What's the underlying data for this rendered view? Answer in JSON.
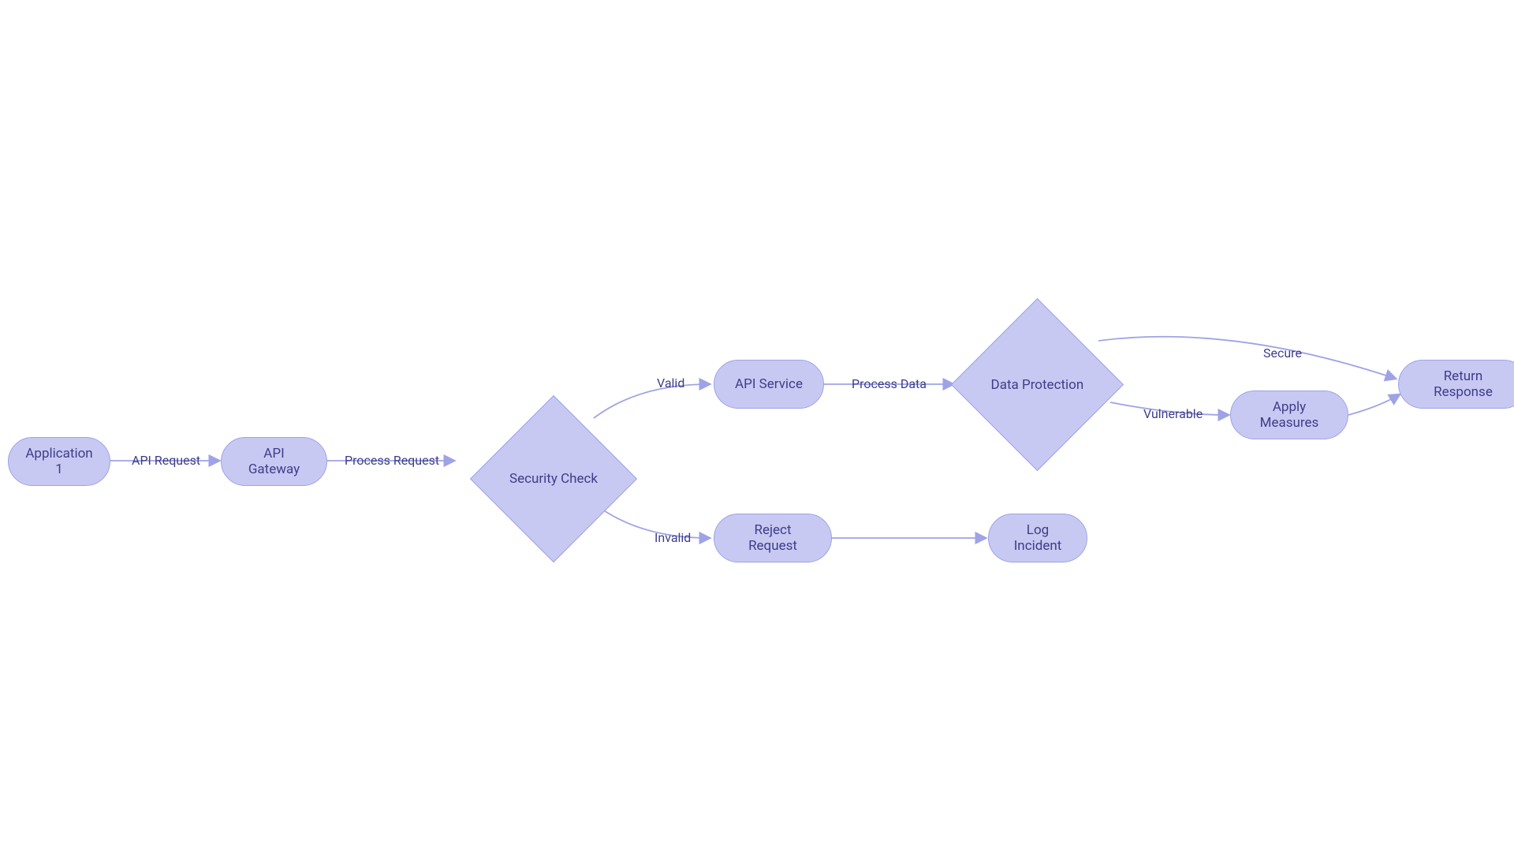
{
  "diagram": {
    "nodes": {
      "app1": "Application 1",
      "gateway": "API Gateway",
      "security": "Security Check",
      "service": "API Service",
      "reject": "Reject Request",
      "protection": "Data Protection",
      "log": "Log Incident",
      "measures": "Apply Measures",
      "response": "Return Response"
    },
    "edges": {
      "api_request": "API Request",
      "process_request": "Process Request",
      "valid": "Valid",
      "invalid": "Invalid",
      "process_data": "Process Data",
      "secure": "Secure",
      "vulnerable": "Vulnerable"
    }
  }
}
